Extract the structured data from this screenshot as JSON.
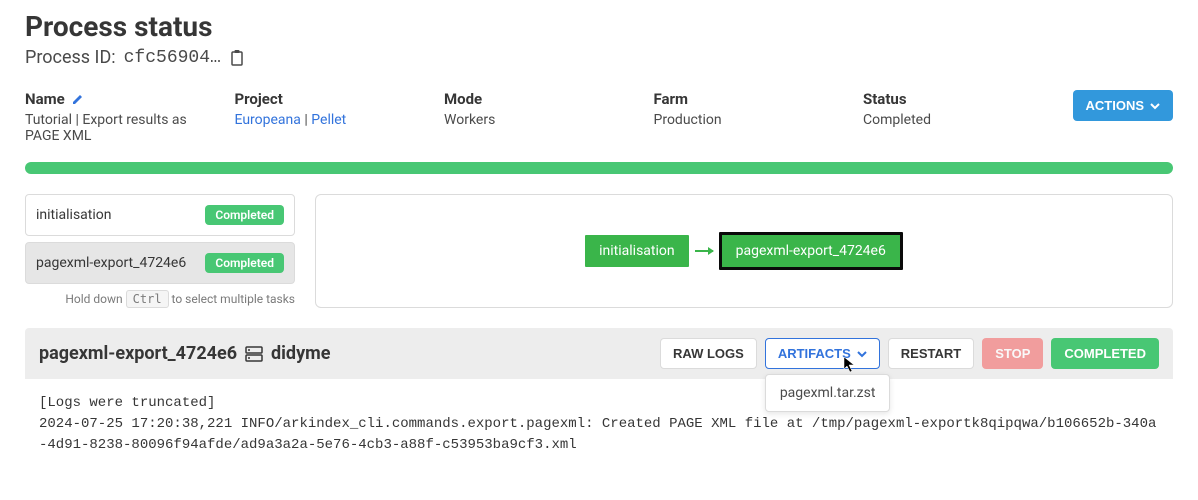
{
  "header": {
    "title": "Process status",
    "process_id_label": "Process ID:",
    "process_id": "cfc56904…"
  },
  "info": {
    "name_label": "Name",
    "name_value": "Tutorial | Export results as PAGE XML",
    "project_label": "Project",
    "project_link1": "Europeana",
    "project_sep": " | ",
    "project_link2": "Pellet",
    "mode_label": "Mode",
    "mode_value": "Workers",
    "farm_label": "Farm",
    "farm_value": "Production",
    "status_label": "Status",
    "status_value": "Completed",
    "actions_label": "ACTIONS"
  },
  "tasks": {
    "items": [
      {
        "name": "initialisation",
        "status": "Completed"
      },
      {
        "name": "pagexml-export_4724e6",
        "status": "Completed"
      }
    ],
    "hint_prefix": "Hold down",
    "hint_key": "Ctrl",
    "hint_suffix": "to select multiple tasks"
  },
  "graph": {
    "node1": "initialisation",
    "node2": "pagexml-export_4724e6"
  },
  "detail": {
    "task_name": "pagexml-export_4724e6",
    "worker": "didyme",
    "buttons": {
      "raw_logs": "RAW LOGS",
      "artifacts": "ARTIFACTS",
      "restart": "RESTART",
      "stop": "STOP",
      "completed": "COMPLETED"
    },
    "artifact_item": "pagexml.tar.zst",
    "logs": "[Logs were truncated]\n2024-07-25 17:20:38,221 INFO/arkindex_cli.commands.export.pagexml: Created PAGE XML file at /tmp/pagexml-exportk8qipqwa/b106652b-340a-4d91-8238-80096f94afde/ad9a3a2a-5e76-4cb3-a88f-c53953ba9cf3.xml"
  }
}
